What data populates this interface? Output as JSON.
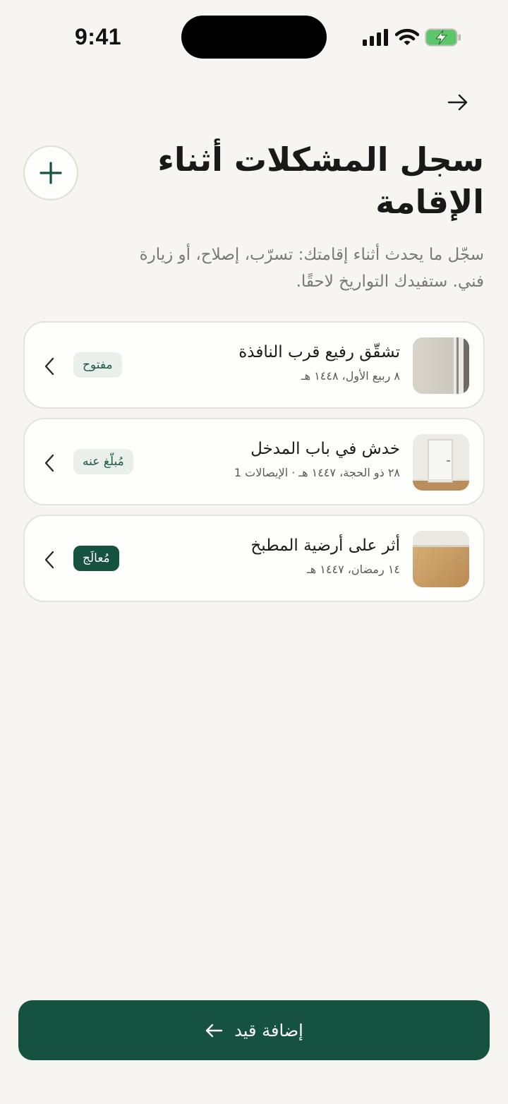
{
  "status_bar": {
    "time": "9:41"
  },
  "header": {
    "title": "سجل المشكلات أثناء الإقامة",
    "subtitle": "سجّل ما يحدث أثناء إقامتك: تسرّب، إصلاح، أو زيارة فني. ستفيدك التواريخ لاحقًا."
  },
  "issues": [
    {
      "title": "تشقّق رفيع قرب النافذة",
      "meta": "٨ ربيع الأول، ١٤٤٨ هـ",
      "status": "مفتوح",
      "thumb": "wall-window"
    },
    {
      "title": "خدش في باب المدخل",
      "meta": "٢٨ ذو الحجة، ١٤٤٧ هـ · الإيصالات 1",
      "status": "مُبلّغ عنه",
      "thumb": "door"
    },
    {
      "title": "أثر على أرضية المطبخ",
      "meta": "١٤ رمضان، ١٤٤٧ هـ",
      "status": "مُعالَج",
      "thumb": "wood-floor"
    }
  ],
  "footer": {
    "add_label": "إضافة قيد"
  },
  "colors": {
    "accent": "#155240",
    "background": "#f6f5f1",
    "badge_light": "#e9f0ec"
  }
}
